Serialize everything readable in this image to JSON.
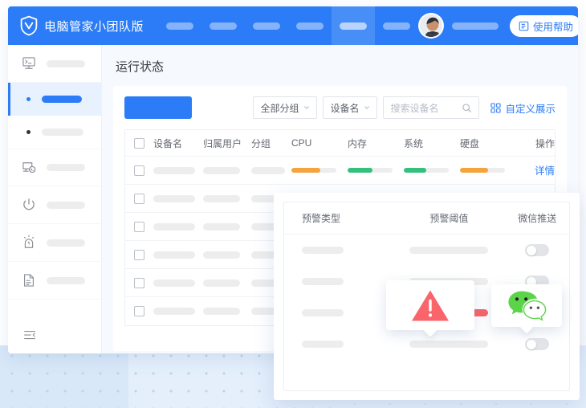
{
  "header": {
    "brand_title": "电脑管家小团队版",
    "logo_icon": "shield-check-icon",
    "nav_pills": [
      {
        "id": "nav-1",
        "active": false
      },
      {
        "id": "nav-2",
        "active": false
      },
      {
        "id": "nav-3",
        "active": false
      },
      {
        "id": "nav-4",
        "active": false
      },
      {
        "id": "nav-5",
        "active": true
      },
      {
        "id": "nav-6",
        "active": false
      }
    ],
    "avatar": "user-avatar",
    "username_placeholder": "",
    "help_button": {
      "label": "使用帮助",
      "icon": "book-icon"
    },
    "accent_color": "#2b7cf6"
  },
  "sidebar": {
    "items": [
      {
        "icon": "terminal-monitor-icon",
        "label": "",
        "active": false,
        "type": "icon"
      },
      {
        "icon": "bullet-dot-icon",
        "label": "",
        "active": true,
        "type": "sub"
      },
      {
        "icon": "bullet-dot-icon",
        "label": "",
        "active": false,
        "type": "sub"
      },
      {
        "icon": "remote-desktop-icon",
        "label": "",
        "active": false,
        "type": "icon"
      },
      {
        "icon": "power-icon",
        "label": "",
        "active": false,
        "type": "icon"
      },
      {
        "icon": "alarm-siren-icon",
        "label": "",
        "active": false,
        "type": "icon"
      },
      {
        "icon": "document-icon",
        "label": "",
        "active": false,
        "type": "icon"
      }
    ],
    "collapse_icon": "collapse-menu-icon"
  },
  "main": {
    "page_title": "运行状态",
    "toolbar": {
      "primary_button_label": "",
      "group_select": {
        "value": "全部分组",
        "icon": "chevron-down-icon"
      },
      "field_select": {
        "value": "设备名",
        "icon": "chevron-down-icon"
      },
      "search": {
        "placeholder": "搜索设备名",
        "value": "",
        "icon": "search-icon"
      },
      "custom_display": {
        "label": "自定义展示",
        "icon": "grid-squares-icon"
      }
    },
    "table": {
      "columns": [
        "设备名",
        "归属用户",
        "分组",
        "CPU",
        "内存",
        "系统",
        "硬盘",
        "操作"
      ],
      "detail_link_label": "详情",
      "rows": [
        {
          "selected": false,
          "cpu": {
            "percent": 65,
            "color": "#f5a33c"
          },
          "memory": {
            "percent": 55,
            "color": "#35c07c"
          },
          "system": {
            "percent": 50,
            "color": "#35c07c"
          },
          "disk": {
            "percent": 62,
            "color": "#f5a33c"
          },
          "has_action": true
        },
        {
          "selected": false,
          "has_action": false
        },
        {
          "selected": false,
          "has_action": false
        },
        {
          "selected": false,
          "has_action": false
        },
        {
          "selected": false,
          "has_action": false
        },
        {
          "selected": false,
          "has_action": false
        }
      ]
    }
  },
  "overlay": {
    "columns": [
      "预警类型",
      "预警阈值",
      "微信推送"
    ],
    "rows": [
      {
        "toggle_on": false,
        "threshold_alert": false
      },
      {
        "toggle_on": false,
        "threshold_alert": false
      },
      {
        "toggle_on": true,
        "threshold_alert": true
      },
      {
        "toggle_on": false,
        "threshold_alert": false
      }
    ],
    "warning_callout": {
      "icon": "warning-triangle-icon",
      "color": "#f9656a"
    },
    "wechat_callout": {
      "icon": "wechat-icon",
      "color": "#06c160"
    }
  }
}
